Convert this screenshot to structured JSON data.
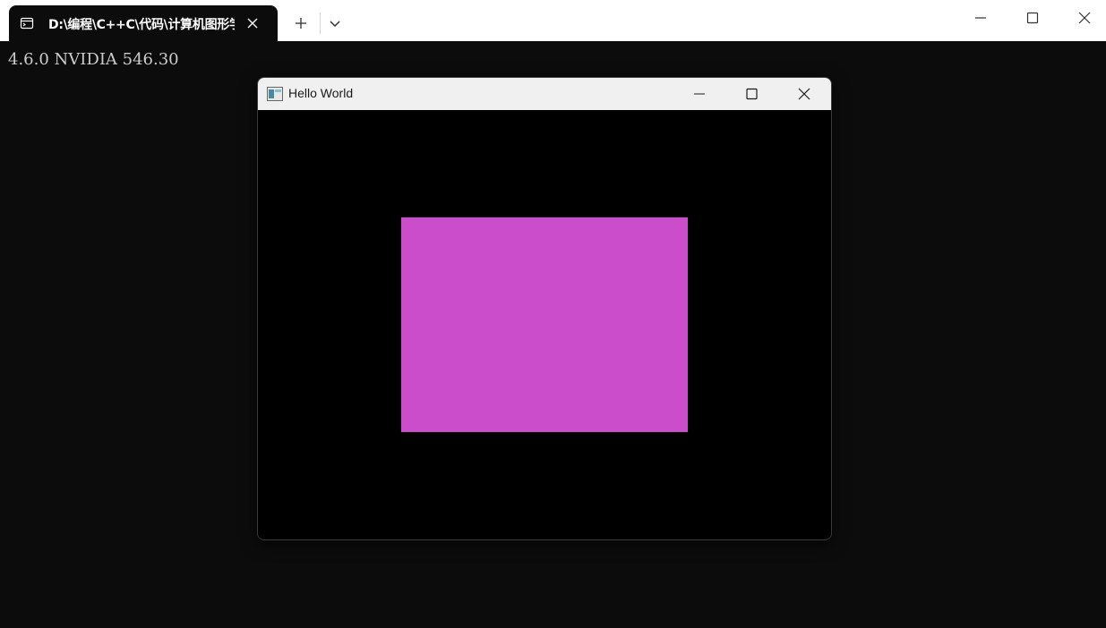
{
  "terminal": {
    "tab_title": "D:\\编程\\C++C\\代码\\计算机图形学",
    "tab_icon": "terminal-icon",
    "new_tab_icon": "plus-icon",
    "dropdown_icon": "chevron-down-icon",
    "controls": [
      "minimize-icon",
      "maximize-icon",
      "close-icon"
    ],
    "output_line": "4.6.0 NVIDIA 546.30",
    "background_color": "#0c0c0c"
  },
  "glfw_window": {
    "title": "Hello World",
    "app_icon": "app-window-icon",
    "controls": [
      "minimize-icon",
      "maximize-icon",
      "close-icon"
    ],
    "clear_color": "#000000",
    "rectangle_color": "#cc4dcc"
  }
}
